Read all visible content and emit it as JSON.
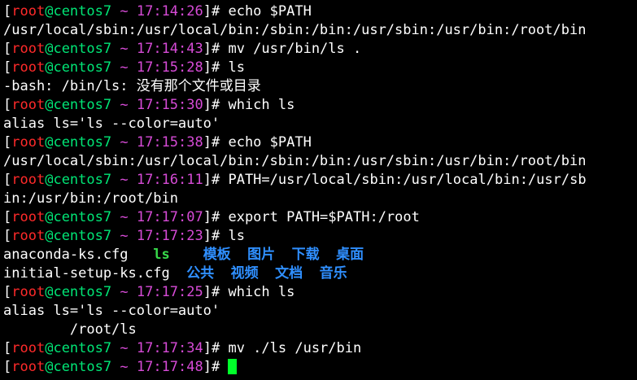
{
  "terminal": {
    "user": "root",
    "host": "centos7",
    "cwd": "~",
    "colors": {
      "user": "#ff2a2a",
      "host": "#00e676",
      "time": "#d64bd6",
      "text": "#ffffff",
      "exec": "#38d94a",
      "dir": "#2f8fff",
      "cursor": "#00ff2a",
      "background": "#000000"
    },
    "lines": [
      {
        "type": "prompt",
        "time": "17:14:26",
        "cmd": "echo $PATH"
      },
      {
        "type": "out",
        "text": "/usr/local/sbin:/usr/local/bin:/sbin:/bin:/usr/sbin:/usr/bin:/root/bin"
      },
      {
        "type": "prompt",
        "time": "17:14:43",
        "cmd": "mv /usr/bin/ls ."
      },
      {
        "type": "prompt",
        "time": "17:15:28",
        "cmd": "ls"
      },
      {
        "type": "out",
        "text": "-bash: /bin/ls: 没有那个文件或目录"
      },
      {
        "type": "prompt",
        "time": "17:15:30",
        "cmd": "which ls"
      },
      {
        "type": "out",
        "text": "alias ls='ls --color=auto'"
      },
      {
        "type": "prompt",
        "time": "17:15:38",
        "cmd": "echo $PATH"
      },
      {
        "type": "out",
        "text": "/usr/local/sbin:/usr/local/bin:/sbin:/bin:/usr/sbin:/usr/bin:/root/bin"
      },
      {
        "type": "prompt",
        "time": "17:16:11",
        "cmd": "PATH=/usr/local/sbin:/usr/local/bin:/usr/sb"
      },
      {
        "type": "out",
        "text": "in:/usr/bin:/root/bin"
      },
      {
        "type": "prompt",
        "time": "17:17:07",
        "cmd": "export PATH=$PATH:/root"
      },
      {
        "type": "prompt",
        "time": "17:17:23",
        "cmd": "ls"
      },
      {
        "type": "ls",
        "items": [
          {
            "text": "anaconda-ks.cfg",
            "kind": "file",
            "pad": 3
          },
          {
            "text": "ls",
            "kind": "exec",
            "pad": 4
          },
          {
            "text": "模板",
            "kind": "dir",
            "pad": 2
          },
          {
            "text": "图片",
            "kind": "dir",
            "pad": 2
          },
          {
            "text": "下载",
            "kind": "dir",
            "pad": 2
          },
          {
            "text": "桌面",
            "kind": "dir",
            "pad": 0
          }
        ]
      },
      {
        "type": "ls",
        "items": [
          {
            "text": "initial-setup-ks.cfg",
            "kind": "file",
            "pad": 2
          },
          {
            "text": "公共",
            "kind": "dir",
            "pad": 2
          },
          {
            "text": "视频",
            "kind": "dir",
            "pad": 2
          },
          {
            "text": "文档",
            "kind": "dir",
            "pad": 2
          },
          {
            "text": "音乐",
            "kind": "dir",
            "pad": 0
          }
        ]
      },
      {
        "type": "prompt",
        "time": "17:17:25",
        "cmd": "which ls"
      },
      {
        "type": "out",
        "text": "alias ls='ls --color=auto'"
      },
      {
        "type": "out",
        "text": "        /root/ls"
      },
      {
        "type": "prompt",
        "time": "17:17:34",
        "cmd": "mv ./ls /usr/bin"
      },
      {
        "type": "prompt",
        "time": "17:17:48",
        "cmd": "",
        "cursor": true
      }
    ]
  }
}
